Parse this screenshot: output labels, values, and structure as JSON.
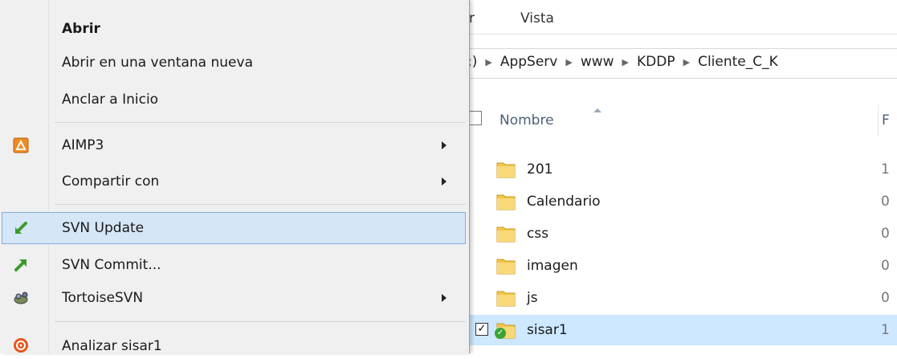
{
  "explorer": {
    "ribbon_tab_partial": "r",
    "ribbon_tab": "Vista",
    "breadcrumb": [
      ":)",
      "AppServ",
      "www",
      "KDDP",
      "Cliente_C_K"
    ],
    "column_header": "Nombre",
    "column_header_stub": "F",
    "rows": [
      {
        "name": "201",
        "stub": "1"
      },
      {
        "name": "Calendario",
        "stub": "0"
      },
      {
        "name": "css",
        "stub": "0"
      },
      {
        "name": "imagen",
        "stub": "0"
      },
      {
        "name": "js",
        "stub": "0"
      },
      {
        "name": "sisar1",
        "stub": "1"
      }
    ],
    "selected_check": "✓"
  },
  "context_menu": {
    "items": [
      {
        "label": "Abrir"
      },
      {
        "label": "Abrir en una ventana nueva"
      },
      {
        "label": "Anclar a Inicio"
      },
      {
        "label": "AIMP3",
        "icon": "aimp-icon"
      },
      {
        "label": "Compartir con"
      },
      {
        "label": "SVN Update",
        "icon": "svn-update-icon"
      },
      {
        "label": "SVN Commit...",
        "icon": "svn-commit-icon"
      },
      {
        "label": "TortoiseSVN",
        "icon": "tortoisesvn-icon"
      },
      {
        "label": "Analizar sisar1",
        "icon": "scan-icon"
      }
    ]
  },
  "colors": {
    "menu_bg": "#f0f0f0",
    "highlight_bg": "#d5e6f7",
    "highlight_border": "#84acd8",
    "selection_bg": "#cde8ff",
    "folder_yellow": "#f3c64b"
  }
}
